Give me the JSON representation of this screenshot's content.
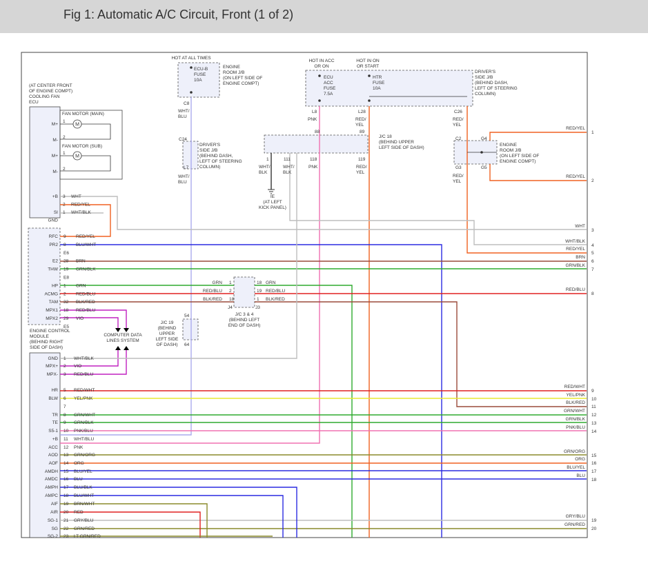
{
  "title": "Fig 1: Automatic A/C Circuit, Front (1 of 2)",
  "colors": {
    "bg": "#ffffff",
    "titlebar": "#d6d6d6",
    "grn": "#2eaa2e",
    "red": "#e02020",
    "blue": "#2a2ae0",
    "orange": "#f06020",
    "pink": "#f070b0",
    "gray": "#bdbdbd",
    "lavender": "#aaaaee",
    "brown": "#9a4a3a",
    "olive": "#8a8a2a",
    "yellow": "#e8e830",
    "magenta": "#c020c0",
    "box_fill": "#eef0fa"
  },
  "top": {
    "hot_all": "HOT AT ALL TIMES",
    "ecub_fuse": [
      "ECU-B",
      "FUSE",
      "10A"
    ],
    "engine_room_jb": [
      "ENGINE",
      "ROOM J/B",
      "(ON LEFT SIDE OF",
      "ENGINE COMPT)"
    ],
    "c8": "C8",
    "wire_wht_blu": [
      "WHT/",
      "BLU"
    ],
    "hot_acc": [
      "HOT IN ACC",
      "OR ON"
    ],
    "hot_on": [
      "HOT IN ON",
      "OR START"
    ],
    "ecu_acc_fuse": [
      "ECU",
      "ACC",
      "FUSE",
      "7.5A"
    ],
    "htr_fuse": [
      "HTR",
      "FUSE",
      "10A"
    ],
    "drivers_side_jb": [
      "DRIVER'S",
      "SIDE J/B",
      "(BEHIND DASH,",
      "LEFT OF STEERING",
      "COLUMN)"
    ],
    "l8": "L8",
    "l28": "L28",
    "c26": "C26",
    "pnk": "PNK",
    "red_yel": [
      "RED/",
      "YEL"
    ],
    "cooling_fan": [
      "(AT CENTER FRONT",
      "OF ENGINE COMPT)",
      "COOLING FAN",
      "ECU"
    ]
  },
  "fan": {
    "main": "FAN MOTOR (MAIN)",
    "sub": "FAN MOTOR (SUB)",
    "m_plus": "M+",
    "m_minus": "M-",
    "pin1": "1",
    "pin2": "2"
  },
  "ecu_top_pins": [
    {
      "name": "+B",
      "pin": "3",
      "wire": "WHT"
    },
    {
      "name": "",
      "pin": "2",
      "wire": "RED/YEL"
    },
    {
      "name": "SI",
      "pin": "1",
      "wire": "WHT/BLK"
    },
    {
      "name": "GND",
      "pin": "",
      "wire": ""
    }
  ],
  "jc24": {
    "c24": "C24",
    "l7": "L7",
    "label": [
      "DRIVER'S",
      "SIDE J/B",
      "(BEHIND DASH,",
      "LEFT OF STEERING",
      "COLUMN)"
    ],
    "wire": [
      "WHT/",
      "BLU"
    ]
  },
  "jc18": {
    "label": [
      "J/C 18",
      "(BEHIND UPPER",
      "LEFT SIDE OF DASH)"
    ],
    "pins_top": [
      "88",
      "89"
    ],
    "pins_bottom": [
      "1",
      "111",
      "118",
      "119"
    ],
    "wires": [
      [
        "WHT/",
        "BLK"
      ],
      [
        "WHT/",
        "BLK"
      ],
      [
        "PNK"
      ],
      [
        "RED/",
        "YEL"
      ]
    ],
    "ground": [
      "IE",
      "(AT LEFT",
      "KICK PANEL)"
    ]
  },
  "engine_room_jb2": {
    "c2": "C2",
    "g4": "G4",
    "g3": "G3",
    "g5": "G5",
    "label": [
      "ENGINE",
      "ROOM J/B",
      "(ON LEFT SIDE OF",
      "ENGINE COMPT)"
    ],
    "wire": [
      "RED/",
      "YEL"
    ]
  },
  "ecm_pins_top": [
    {
      "name": "RFC",
      "pin": "9",
      "wire": "RED/YEL"
    },
    {
      "name": "PR2",
      "pin": "8",
      "wire": "BLU/WHT"
    },
    {
      "name": "",
      "pin": "E6",
      "wire": ""
    },
    {
      "name": "E2",
      "pin": "28",
      "wire": "BRN"
    },
    {
      "name": "THW",
      "pin": "19",
      "wire": "GRN/BLK"
    },
    {
      "name": "",
      "pin": "E8",
      "wire": ""
    },
    {
      "name": "HP",
      "pin": "1",
      "wire": "GRN"
    },
    {
      "name": "ACMG",
      "pin": "2",
      "wire": "RED/BLU"
    },
    {
      "name": "TAM",
      "pin": "32",
      "wire": "BLK/RED"
    },
    {
      "name": "MPX1",
      "pin": "18",
      "wire": "RED/BLU"
    },
    {
      "name": "MPX2",
      "pin": "29",
      "wire": "VIO"
    },
    {
      "name": "",
      "pin": "E5",
      "wire": ""
    }
  ],
  "jc34": {
    "left": [
      {
        "wire": "GRN",
        "pin": "1"
      },
      {
        "wire": "RED/BLU",
        "pin": "2"
      },
      {
        "wire": "BLK/RED",
        "pin": "18"
      }
    ],
    "right": [
      {
        "pin": "18",
        "wire": "GRN"
      },
      {
        "pin": "19",
        "wire": "RED/BLU"
      },
      {
        "pin": "1",
        "wire": "BLK/RED"
      }
    ],
    "j4": "J4",
    "j3": "J3",
    "label": [
      "J/C 3 & 4",
      "(BEHIND LEFT",
      "END OF DASH)"
    ]
  },
  "jc19": {
    "label": [
      "J/C 19",
      "(BEHIND",
      "UPPER",
      "LEFT SIDE",
      "OF DASH)"
    ],
    "pin_top": "54",
    "pin_bottom": "64"
  },
  "ecm_label": [
    "ENGINE CONTROL",
    "MODULE",
    "(BEHIND RIGHT",
    "SIDE OF DASH)"
  ],
  "data_lines": [
    "COMPUTER DATA",
    "LINES SYSTEM"
  ],
  "ecm_pins_bottom": [
    {
      "name": "GND",
      "pin": "1",
      "wire": "WHT/BLK"
    },
    {
      "name": "MPX+",
      "pin": "2",
      "wire": "VIO"
    },
    {
      "name": "MPX-",
      "pin": "3",
      "wire": "RED/BLU"
    },
    {
      "name": "HR",
      "pin": "5",
      "wire": "RED/WHT"
    },
    {
      "name": "BLW",
      "pin": "6",
      "wire": "YEL/PNK"
    },
    {
      "name": "",
      "pin": "7",
      "wire": ""
    },
    {
      "name": "TR",
      "pin": "8",
      "wire": "GRN/WHT"
    },
    {
      "name": "TE",
      "pin": "9",
      "wire": "GRN/BLK"
    },
    {
      "name": "S5-1",
      "pin": "10",
      "wire": "PNK/BLU"
    },
    {
      "name": "+B",
      "pin": "11",
      "wire": "WHT/BLU"
    },
    {
      "name": "ACC",
      "pin": "12",
      "wire": "PNK"
    },
    {
      "name": "AOD",
      "pin": "13",
      "wire": "GRN/ORG"
    },
    {
      "name": "AOF",
      "pin": "14",
      "wire": "ORG"
    },
    {
      "name": "AMDH",
      "pin": "15",
      "wire": "BLU/YEL"
    },
    {
      "name": "AMDC",
      "pin": "16",
      "wire": "BLU"
    },
    {
      "name": "AMPH",
      "pin": "17",
      "wire": "BLU/BLK"
    },
    {
      "name": "AMPC",
      "pin": "18",
      "wire": "BLU/WHT"
    },
    {
      "name": "AIF",
      "pin": "19",
      "wire": "BRN/WHT"
    },
    {
      "name": "AIR",
      "pin": "20",
      "wire": "RED"
    },
    {
      "name": "SG-1",
      "pin": "21",
      "wire": "GRY/BLU"
    },
    {
      "name": "SG",
      "pin": "22",
      "wire": "GRN/RED"
    },
    {
      "name": "SG-2",
      "pin": "23",
      "wire": "LT GRN/RED"
    }
  ],
  "right_labels": [
    {
      "wire": "RED/YEL",
      "num": "1"
    },
    {
      "wire": "RED/YEL",
      "num": "2"
    },
    {
      "wire": "WHT",
      "num": "3"
    },
    {
      "wire": "WHT/BLK",
      "num": "4"
    },
    {
      "wire": "RED/YEL",
      "num": "5"
    },
    {
      "wire": "BRN",
      "num": "6"
    },
    {
      "wire": "GRN/BLK",
      "num": "7"
    },
    {
      "wire": "RED/BLU",
      "num": "8"
    },
    {
      "wire": "RED/WHT",
      "num": "9"
    },
    {
      "wire": "YEL/PNK",
      "num": "10"
    },
    {
      "wire": "BLK/RED",
      "num": "11"
    },
    {
      "wire": "GRN/WHT",
      "num": "12"
    },
    {
      "wire": "GRN/BLK",
      "num": "13"
    },
    {
      "wire": "PNK/BLU",
      "num": "14"
    },
    {
      "wire": "GRN/ORG",
      "num": "15"
    },
    {
      "wire": "ORG",
      "num": "16"
    },
    {
      "wire": "BLU/YEL",
      "num": "17"
    },
    {
      "wire": "BLU",
      "num": "18"
    },
    {
      "wire": "GRY/BLU",
      "num": "19"
    },
    {
      "wire": "GRN/RED",
      "num": "20"
    }
  ]
}
